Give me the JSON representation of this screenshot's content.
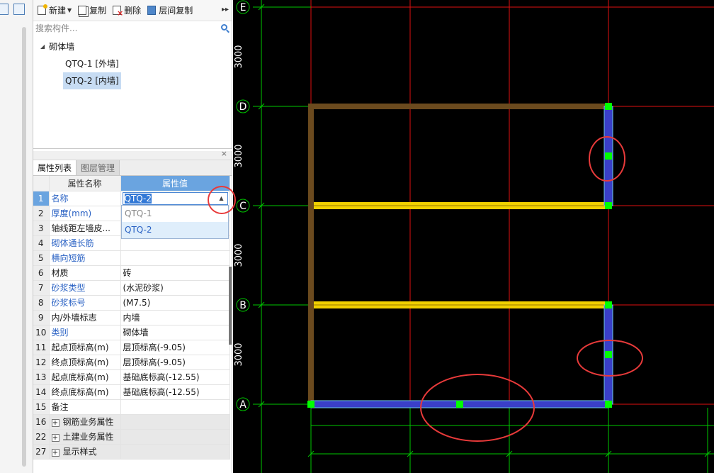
{
  "toolbar": {
    "new_label": "新建",
    "copy_label": "复制",
    "delete_label": "删除",
    "layer_copy_label": "层间复制",
    "more_symbol": "▸▸"
  },
  "search": {
    "placeholder": "搜索构件..."
  },
  "tree": {
    "group_label": "砌体墙",
    "items": [
      {
        "label": "QTQ-1 [外墙]",
        "selected": false
      },
      {
        "label": "QTQ-2 [内墙]",
        "selected": true
      }
    ]
  },
  "properties": {
    "tabs": [
      "属性列表",
      "图层管理"
    ],
    "col_name": "属性名称",
    "col_value": "属性值",
    "name_edit_value": "QTQ-2",
    "dropdown_options": [
      "QTQ-1",
      "QTQ-2"
    ],
    "rows": [
      {
        "num": "1",
        "name": "名称",
        "value": ""
      },
      {
        "num": "2",
        "name": "厚度(mm)",
        "value": ""
      },
      {
        "num": "3",
        "name": "轴线距左墙皮...",
        "value": ""
      },
      {
        "num": "4",
        "name": "砌体通长筋",
        "value": ""
      },
      {
        "num": "5",
        "name": "横向短筋",
        "value": ""
      },
      {
        "num": "6",
        "name": "材质",
        "value": "砖"
      },
      {
        "num": "7",
        "name": "砂浆类型",
        "value": "(水泥砂浆)"
      },
      {
        "num": "8",
        "name": "砂浆标号",
        "value": "(M7.5)"
      },
      {
        "num": "9",
        "name": "内/外墙标志",
        "value": "内墙"
      },
      {
        "num": "10",
        "name": "类别",
        "value": "砌体墙"
      },
      {
        "num": "11",
        "name": "起点顶标高(m)",
        "value": "层顶标高(-9.05)"
      },
      {
        "num": "12",
        "name": "终点顶标高(m)",
        "value": "层顶标高(-9.05)"
      },
      {
        "num": "13",
        "name": "起点底标高(m)",
        "value": "基础底标高(-12.55)"
      },
      {
        "num": "14",
        "name": "终点底标高(m)",
        "value": "基础底标高(-12.55)"
      },
      {
        "num": "15",
        "name": "备注",
        "value": ""
      }
    ],
    "groups": [
      {
        "num": "16",
        "name": "钢筋业务属性"
      },
      {
        "num": "22",
        "name": "土建业务属性"
      },
      {
        "num": "27",
        "name": "显示样式"
      }
    ]
  },
  "cad": {
    "axes": [
      "E",
      "D",
      "C",
      "B",
      "A"
    ],
    "dimensions": [
      "3000",
      "3000",
      "3000",
      "3000"
    ],
    "colors": {
      "background": "#000000",
      "grid_line": "#00c800",
      "axis_line": "#e01010",
      "outer_wall": "#6b4a1e",
      "inner_wall": "#3a3fc8",
      "inner_wall_highlight": "#6fc9e8",
      "beam": "#f0d000",
      "node": "#00ff00",
      "annotation_circle": "#e83a3a"
    }
  }
}
